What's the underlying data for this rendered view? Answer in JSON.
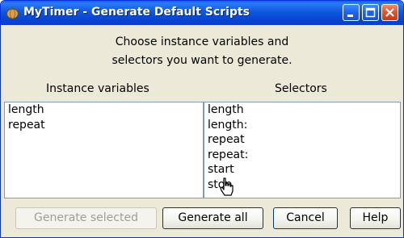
{
  "window": {
    "title": "MyTimer - Generate Default Scripts"
  },
  "instructions": {
    "line1": "Choose instance variables and",
    "line2": "selectors you want to generate."
  },
  "headers": {
    "instance_variables": "Instance variables",
    "selectors": "Selectors"
  },
  "instance_variables": [
    "length",
    "repeat"
  ],
  "selectors": [
    "length",
    "length:",
    "repeat",
    "repeat:",
    "start",
    "stop"
  ],
  "buttons": {
    "generate_selected": "Generate selected",
    "generate_all": "Generate all",
    "cancel": "Cancel",
    "help": "Help"
  },
  "colors": {
    "title_bar": "#0a5fef",
    "window_bg": "#ece9d8",
    "close_button": "#e0502b"
  },
  "icons": {
    "window": "pumpkin-icon",
    "minimize": "minimize-icon",
    "maximize": "maximize-icon",
    "close": "close-icon",
    "cursor": "hand-pointer-icon"
  }
}
